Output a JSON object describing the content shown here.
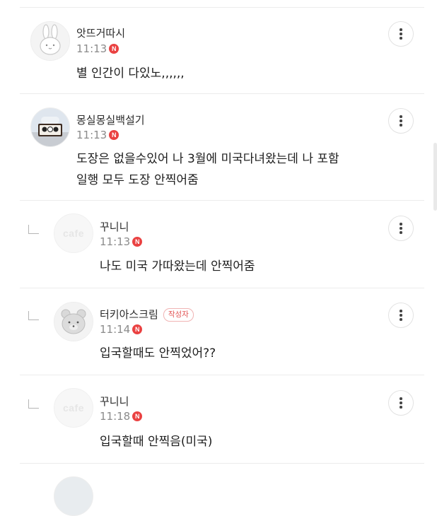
{
  "comments": [
    {
      "nickname": "앗뜨거따시",
      "time": "11:13",
      "new_badge": "N",
      "lines": [
        "별 인간이 다있노,,,,,,"
      ],
      "is_reply": false,
      "avatar_icon": "bunny-avatar-icon"
    },
    {
      "nickname": "몽실몽실백설기",
      "time": "11:13",
      "new_badge": "N",
      "lines": [
        "도장은 없을수있어 나 3월에 미국다녀왔는데 나 포함",
        "일행 모두 도장 안찍어줌"
      ],
      "is_reply": false,
      "avatar_icon": "photo-avatar-icon"
    },
    {
      "nickname": "꾸니니",
      "time": "11:13",
      "new_badge": "N",
      "lines": [
        "나도 미국 가따왔는데 안찍어줌"
      ],
      "is_reply": true,
      "avatar_icon": "cafe-default-avatar",
      "avatar_text": "cafe"
    },
    {
      "nickname": "터키아스크림",
      "author_badge": "작성자",
      "time": "11:14",
      "new_badge": "N",
      "lines": [
        "입국할때도 안찍었어??"
      ],
      "is_reply": true,
      "avatar_icon": "bear-avatar-icon"
    },
    {
      "nickname": "꾸니니",
      "time": "11:18",
      "new_badge": "N",
      "lines": [
        "입국할때 안찍음(미국)"
      ],
      "is_reply": true,
      "avatar_icon": "cafe-default-avatar",
      "avatar_text": "cafe"
    }
  ],
  "icons": {
    "more": "more-vertical-icon",
    "reply": "reply-arrow-icon",
    "new": "new-badge-icon"
  },
  "colors": {
    "new_badge": "#ea4242",
    "author_badge": "#e25555",
    "time": "#8b8b8b",
    "divider": "#ececec"
  }
}
